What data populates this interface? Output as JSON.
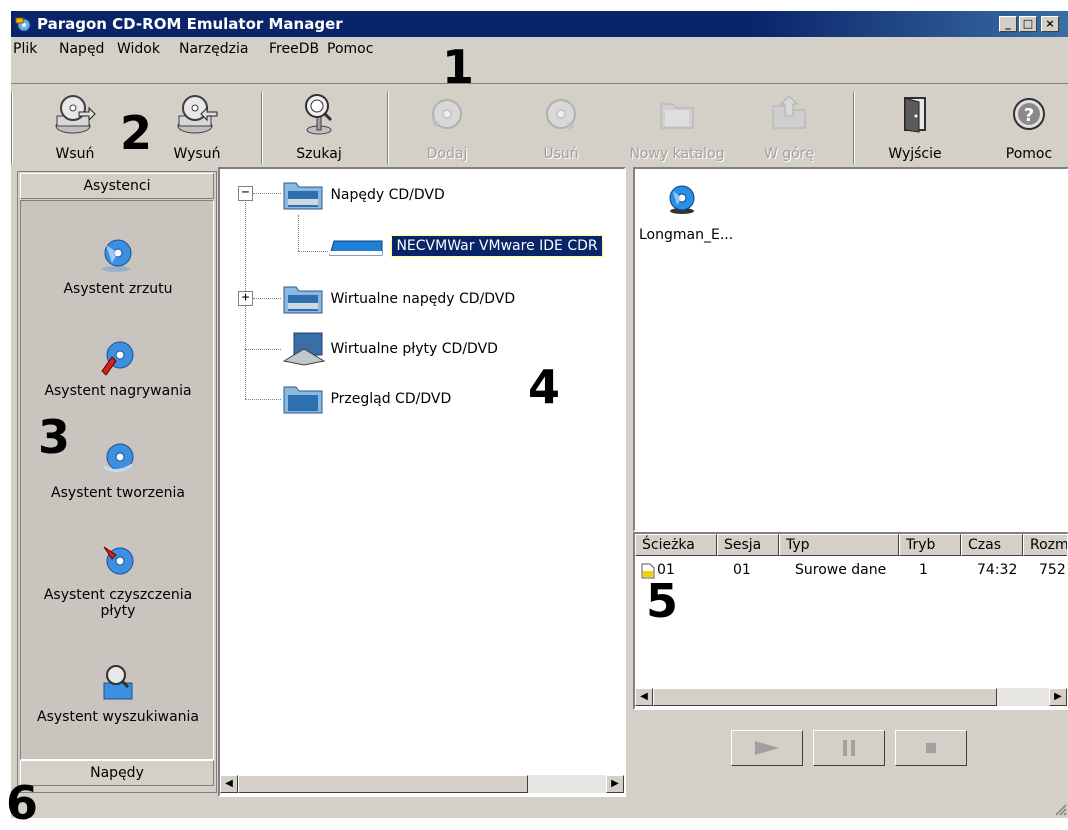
{
  "window": {
    "title": "Paragon CD-ROM Emulator Manager"
  },
  "menu": {
    "items": [
      "Plik",
      "Napęd",
      "Widok",
      "Narzędzia",
      "FreeDB",
      "Pomoc"
    ]
  },
  "toolbar": {
    "buttons": [
      {
        "label": "Wsuń",
        "icon": "insert-disc-icon",
        "enabled": true
      },
      {
        "label": "Wysuń",
        "icon": "eject-disc-icon",
        "enabled": true
      },
      {
        "label": "Szukaj",
        "icon": "search-icon",
        "enabled": true
      },
      {
        "label": "Dodaj",
        "icon": "add-disc-icon",
        "enabled": false
      },
      {
        "label": "Usuń",
        "icon": "remove-disc-icon",
        "enabled": false
      },
      {
        "label": "Nowy katalog",
        "icon": "new-folder-icon",
        "enabled": false
      },
      {
        "label": "W górę",
        "icon": "folder-up-icon",
        "enabled": false
      },
      {
        "label": "Wyjście",
        "icon": "exit-door-icon",
        "enabled": true
      },
      {
        "label": "Pomoc",
        "icon": "help-icon",
        "enabled": true
      }
    ]
  },
  "left_panel": {
    "header_top": "Asystenci",
    "header_bottom": "Napędy",
    "assistants": [
      {
        "label": "Asystent zrzutu",
        "icon": "disc-image-icon"
      },
      {
        "label": "Asystent nagrywania",
        "icon": "disc-burn-icon"
      },
      {
        "label": "Asystent tworzenia",
        "icon": "disc-create-icon"
      },
      {
        "label": "Asystent czyszczenia płyty",
        "icon": "disc-erase-icon"
      },
      {
        "label": "Asystent wyszukiwania",
        "icon": "disc-search-icon"
      }
    ]
  },
  "tree": {
    "nodes": [
      {
        "label": "Napędy CD/DVD",
        "expander": "−"
      },
      {
        "label": "NECVMWar VMware IDE CDR",
        "selected": true
      },
      {
        "label": "Wirtualne napędy CD/DVD",
        "expander": "+"
      },
      {
        "label": "Wirtualne płyty CD/DVD"
      },
      {
        "label": "Przegląd CD/DVD"
      }
    ]
  },
  "files": {
    "items": [
      {
        "label": "Longman_E...",
        "icon": "cd-disc-icon"
      }
    ]
  },
  "tracks": {
    "columns": [
      "Ścieżka",
      "Sesja",
      "Typ",
      "Tryb",
      "Czas",
      "Rozmiar"
    ],
    "rows": [
      [
        "01",
        "01",
        "Surowe dane",
        "1",
        "74:32",
        "752"
      ]
    ]
  },
  "player": {
    "buttons": [
      "play-icon",
      "pause-icon",
      "stop-icon"
    ]
  },
  "annotations": [
    "1",
    "2",
    "3",
    "4",
    "5",
    "6"
  ],
  "colors": {
    "titlebar": "#0a246a",
    "selection": "#0a246a",
    "face": "#d4d0c8"
  }
}
